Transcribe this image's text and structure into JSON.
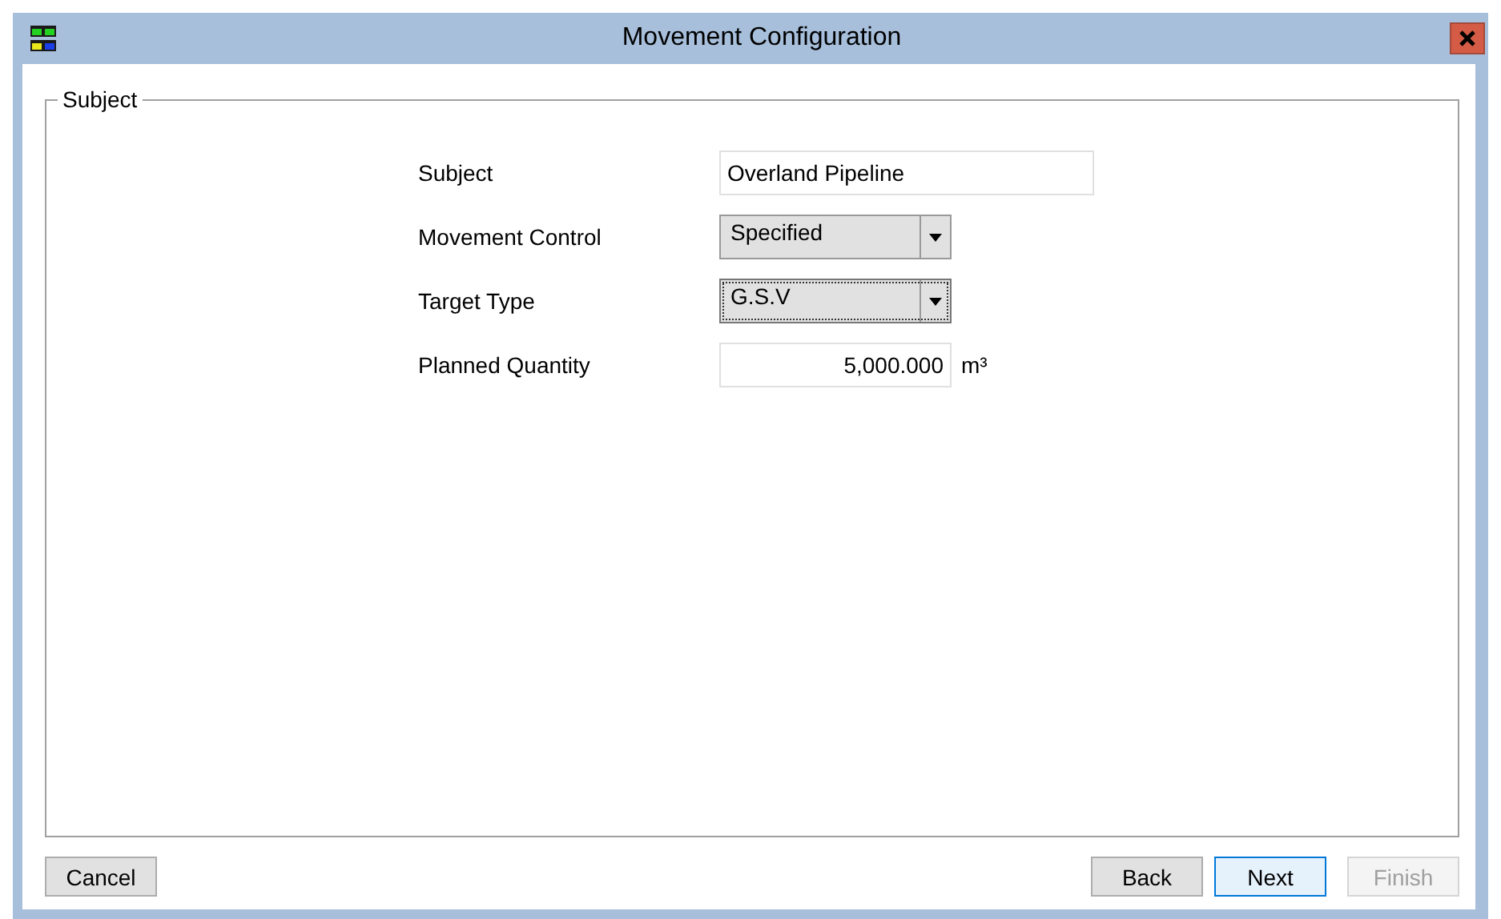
{
  "window": {
    "title": "Movement Configuration"
  },
  "group": {
    "title": "Subject"
  },
  "fields": [
    {
      "kind": "text",
      "label": "Subject",
      "value": "Overland Pipeline",
      "focused": false
    },
    {
      "kind": "combo",
      "label": "Movement Control",
      "value": "Specified",
      "focused": false
    },
    {
      "kind": "combo",
      "label": "Target Type",
      "value": "G.S.V",
      "focused": true
    },
    {
      "kind": "number",
      "label": "Planned Quantity",
      "value": "5,000.000",
      "unit": "m³",
      "focused": false
    }
  ],
  "left_buttons": [
    {
      "label": "Cancel",
      "default": false,
      "disabled": false
    }
  ],
  "right_buttons": [
    {
      "label": "Back",
      "default": false,
      "disabled": false
    },
    {
      "label": "Next",
      "default": true,
      "disabled": false
    },
    {
      "label": "Finish",
      "default": false,
      "disabled": true
    }
  ]
}
